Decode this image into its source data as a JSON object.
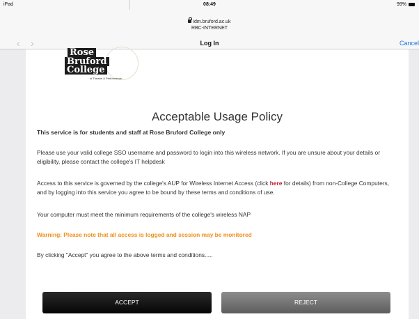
{
  "status_bar": {
    "device": "iPad",
    "time": "08:49",
    "battery": "99%"
  },
  "nav": {
    "url": "idm.bruford.ac.uk",
    "network": "RBC-INTERNET",
    "title": "Log In",
    "cancel_label": "Cancel",
    "back_icon": "chevron-left-icon",
    "forward_icon": "chevron-right-icon"
  },
  "logo": {
    "line1": "Rose",
    "line2": "Bruford",
    "line3": "College",
    "tagline": "of Theatre & Performance"
  },
  "policy": {
    "title": "Acceptable Usage Policy",
    "subtitle": "This service is for students and staff at Rose Bruford College only",
    "p1": "Please use your valid college SSO username and password to login into this wireless network. If you are unsure about your details or eligibility, please contact the college's IT helpdesk",
    "p2_before": "Access to this service is governed by the college's AUP for Wireless Internet Access (click ",
    "p2_link": "here",
    "p2_after": " for details) from non-College Computers, and by logging into this service you agree to be bound by these terms and conditions of use.",
    "p3": "Your computer must meet the minimum requirements of the college's wireless NAP",
    "warning": "Warning: Please note that all access is logged and session may be monitored",
    "p4": "By clicking \"Accept\" you agree to the above terms and conditions....."
  },
  "buttons": {
    "accept": "ACCEPT",
    "reject": "REJECT"
  },
  "colors": {
    "accent": "#1a73e8",
    "warning": "#ef8f1c",
    "link": "#c0152c"
  }
}
